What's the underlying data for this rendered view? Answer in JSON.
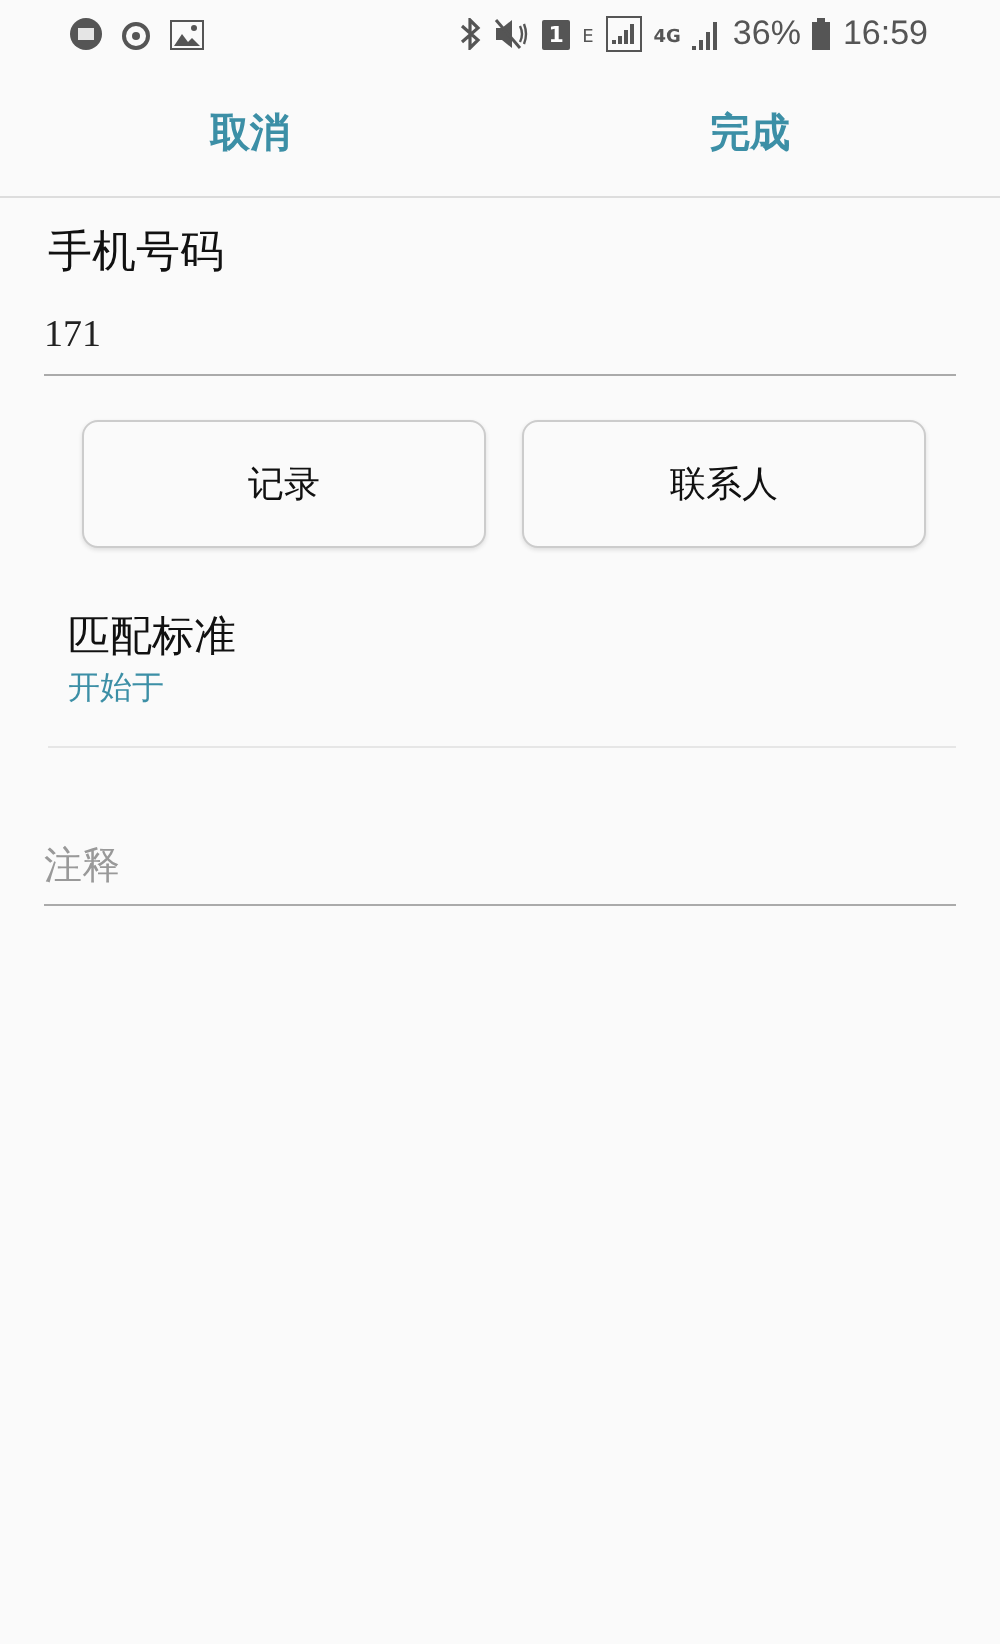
{
  "status_bar": {
    "sim_slot": "1",
    "network_type": "E",
    "data_type": "4G",
    "battery": "36%",
    "time": "16:59"
  },
  "header": {
    "cancel": "取消",
    "done": "完成"
  },
  "phone_field": {
    "label": "手机号码",
    "value": "171"
  },
  "buttons": [
    "记录",
    "联系人"
  ],
  "match_criteria": {
    "title": "匹配标准",
    "value": "开始于"
  },
  "note_field": {
    "placeholder": "注释"
  }
}
